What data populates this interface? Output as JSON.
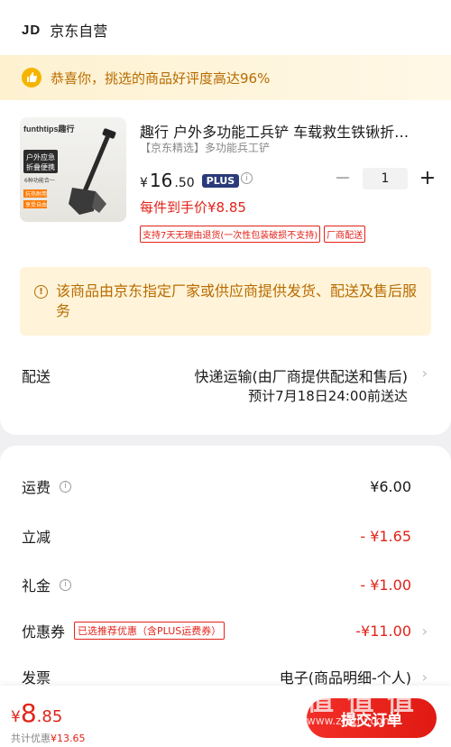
{
  "shop": {
    "logo": "JD",
    "name": "京东自营"
  },
  "praise_banner": {
    "text": "恭喜你，挑选的商品好评度高达96%"
  },
  "product": {
    "image_brand": "funthtips趣行",
    "image_lines": [
      "户外应急",
      "折叠便携",
      "6种功能合一",
      "抗热耐用",
      "享受自由"
    ],
    "title": "趣行 户外多功能工兵铲 车载救生铁锹折…",
    "subtitle": "【京东精选】多功能兵工铲",
    "price_yen": "¥",
    "price_int": "16",
    "price_dec": ".50",
    "plus_badge": "PLUS",
    "info_icon": "i",
    "quantity": "1",
    "minus": "−",
    "plus": "+",
    "final_price": "每件到手价¥8.85",
    "tags": [
      "支持7天无理由退货(一次性包装破损不支持)",
      "厂商配送"
    ]
  },
  "notice": {
    "icon": "!",
    "text": "该商品由京东指定厂家或供应商提供发货、配送及售后服务"
  },
  "shipping": {
    "label": "配送",
    "method": "快递运输(由厂商提供配送和售后)",
    "eta": "预计7月18日24:00前送达",
    "chevron": "›"
  },
  "fees": {
    "freight_label": "运费",
    "freight_value": "¥6.00",
    "reduce_label": "立减",
    "reduce_value": "- ¥1.65",
    "gift_label": "礼金",
    "gift_value": "- ¥1.00",
    "coupon_label": "优惠券",
    "coupon_tag": "已选推荐优惠（含PLUS运费券）",
    "coupon_value": "-¥11.00",
    "invoice_label": "发票",
    "invoice_value": "电子(商品明细-个人)",
    "info_icon": "i",
    "chevron": "›"
  },
  "bottom": {
    "total_yen": "¥",
    "total_int": "8",
    "total_dec": ".85",
    "discount_label": "共计优惠",
    "discount_value": "¥13.65",
    "submit": "提交订单"
  },
  "watermark": {
    "text": "值 值 值",
    "url": "www.zhizhi.com"
  },
  "colors": {
    "accent": "#e2231a",
    "warning": "#b86b00",
    "plus": "#2a3a7a"
  }
}
